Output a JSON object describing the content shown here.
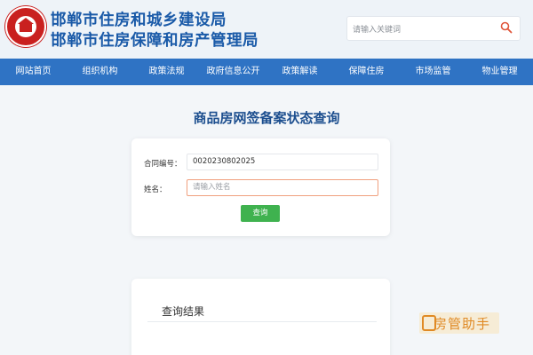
{
  "header": {
    "title_line1": "邯郸市住房和城乡建设局",
    "title_line2": "邯郸市住房保障和房产管理局",
    "search_placeholder": "请输入关键词"
  },
  "nav": {
    "items": [
      "网站首页",
      "组织机构",
      "政策法规",
      "政府信息公开",
      "政策解读",
      "保障住房",
      "市场监管",
      "物业管理"
    ]
  },
  "main": {
    "page_title": "商品房网签备案状态查询"
  },
  "form": {
    "contract_label": "合同编号：",
    "contract_value": "0020230802025",
    "name_label": "姓名：",
    "name_placeholder": "请输入姓名",
    "submit_label": "查询"
  },
  "result": {
    "title": "查询结果"
  },
  "watermark": {
    "text": "房管助手"
  },
  "colors": {
    "brand_blue": "#2f73c4",
    "title_blue": "#1a5aa8",
    "button_green": "#3fb24f",
    "logo_red": "#c9201f",
    "watermark_orange": "#e08a25"
  }
}
